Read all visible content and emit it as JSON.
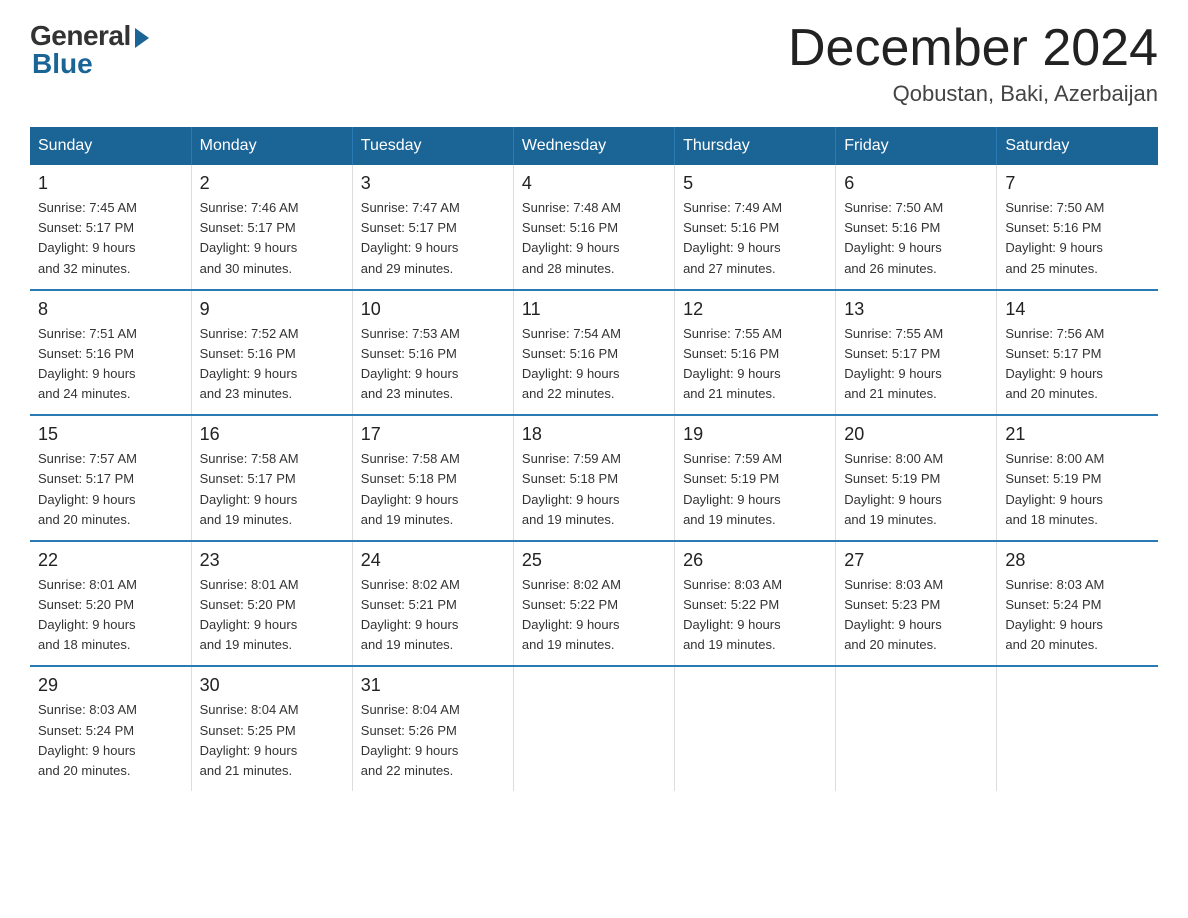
{
  "logo": {
    "general": "General",
    "blue": "Blue"
  },
  "title": {
    "month_year": "December 2024",
    "location": "Qobustan, Baki, Azerbaijan"
  },
  "weekdays": [
    "Sunday",
    "Monday",
    "Tuesday",
    "Wednesday",
    "Thursday",
    "Friday",
    "Saturday"
  ],
  "weeks": [
    [
      {
        "day": "1",
        "sunrise": "7:45 AM",
        "sunset": "5:17 PM",
        "daylight": "9 hours and 32 minutes."
      },
      {
        "day": "2",
        "sunrise": "7:46 AM",
        "sunset": "5:17 PM",
        "daylight": "9 hours and 30 minutes."
      },
      {
        "day": "3",
        "sunrise": "7:47 AM",
        "sunset": "5:17 PM",
        "daylight": "9 hours and 29 minutes."
      },
      {
        "day": "4",
        "sunrise": "7:48 AM",
        "sunset": "5:16 PM",
        "daylight": "9 hours and 28 minutes."
      },
      {
        "day": "5",
        "sunrise": "7:49 AM",
        "sunset": "5:16 PM",
        "daylight": "9 hours and 27 minutes."
      },
      {
        "day": "6",
        "sunrise": "7:50 AM",
        "sunset": "5:16 PM",
        "daylight": "9 hours and 26 minutes."
      },
      {
        "day": "7",
        "sunrise": "7:50 AM",
        "sunset": "5:16 PM",
        "daylight": "9 hours and 25 minutes."
      }
    ],
    [
      {
        "day": "8",
        "sunrise": "7:51 AM",
        "sunset": "5:16 PM",
        "daylight": "9 hours and 24 minutes."
      },
      {
        "day": "9",
        "sunrise": "7:52 AM",
        "sunset": "5:16 PM",
        "daylight": "9 hours and 23 minutes."
      },
      {
        "day": "10",
        "sunrise": "7:53 AM",
        "sunset": "5:16 PM",
        "daylight": "9 hours and 23 minutes."
      },
      {
        "day": "11",
        "sunrise": "7:54 AM",
        "sunset": "5:16 PM",
        "daylight": "9 hours and 22 minutes."
      },
      {
        "day": "12",
        "sunrise": "7:55 AM",
        "sunset": "5:16 PM",
        "daylight": "9 hours and 21 minutes."
      },
      {
        "day": "13",
        "sunrise": "7:55 AM",
        "sunset": "5:17 PM",
        "daylight": "9 hours and 21 minutes."
      },
      {
        "day": "14",
        "sunrise": "7:56 AM",
        "sunset": "5:17 PM",
        "daylight": "9 hours and 20 minutes."
      }
    ],
    [
      {
        "day": "15",
        "sunrise": "7:57 AM",
        "sunset": "5:17 PM",
        "daylight": "9 hours and 20 minutes."
      },
      {
        "day": "16",
        "sunrise": "7:58 AM",
        "sunset": "5:17 PM",
        "daylight": "9 hours and 19 minutes."
      },
      {
        "day": "17",
        "sunrise": "7:58 AM",
        "sunset": "5:18 PM",
        "daylight": "9 hours and 19 minutes."
      },
      {
        "day": "18",
        "sunrise": "7:59 AM",
        "sunset": "5:18 PM",
        "daylight": "9 hours and 19 minutes."
      },
      {
        "day": "19",
        "sunrise": "7:59 AM",
        "sunset": "5:19 PM",
        "daylight": "9 hours and 19 minutes."
      },
      {
        "day": "20",
        "sunrise": "8:00 AM",
        "sunset": "5:19 PM",
        "daylight": "9 hours and 19 minutes."
      },
      {
        "day": "21",
        "sunrise": "8:00 AM",
        "sunset": "5:19 PM",
        "daylight": "9 hours and 18 minutes."
      }
    ],
    [
      {
        "day": "22",
        "sunrise": "8:01 AM",
        "sunset": "5:20 PM",
        "daylight": "9 hours and 18 minutes."
      },
      {
        "day": "23",
        "sunrise": "8:01 AM",
        "sunset": "5:20 PM",
        "daylight": "9 hours and 19 minutes."
      },
      {
        "day": "24",
        "sunrise": "8:02 AM",
        "sunset": "5:21 PM",
        "daylight": "9 hours and 19 minutes."
      },
      {
        "day": "25",
        "sunrise": "8:02 AM",
        "sunset": "5:22 PM",
        "daylight": "9 hours and 19 minutes."
      },
      {
        "day": "26",
        "sunrise": "8:03 AM",
        "sunset": "5:22 PM",
        "daylight": "9 hours and 19 minutes."
      },
      {
        "day": "27",
        "sunrise": "8:03 AM",
        "sunset": "5:23 PM",
        "daylight": "9 hours and 20 minutes."
      },
      {
        "day": "28",
        "sunrise": "8:03 AM",
        "sunset": "5:24 PM",
        "daylight": "9 hours and 20 minutes."
      }
    ],
    [
      {
        "day": "29",
        "sunrise": "8:03 AM",
        "sunset": "5:24 PM",
        "daylight": "9 hours and 20 minutes."
      },
      {
        "day": "30",
        "sunrise": "8:04 AM",
        "sunset": "5:25 PM",
        "daylight": "9 hours and 21 minutes."
      },
      {
        "day": "31",
        "sunrise": "8:04 AM",
        "sunset": "5:26 PM",
        "daylight": "9 hours and 22 minutes."
      },
      null,
      null,
      null,
      null
    ]
  ],
  "labels": {
    "sunrise": "Sunrise:",
    "sunset": "Sunset:",
    "daylight": "Daylight:"
  }
}
